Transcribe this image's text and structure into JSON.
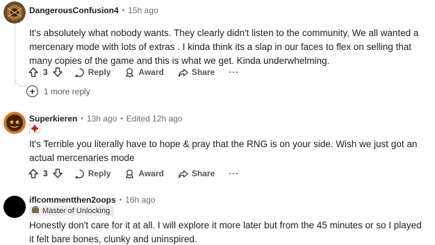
{
  "comments": [
    {
      "username": "DangerousConfusion4",
      "timestamp": "15h ago",
      "edited": "",
      "flair": "",
      "body": "It's absolutely what nobody wants. They clearly didn't listen to the community, We all wanted a mercenary mode with lots of extras . I kinda think its a slap in our faces to flex on selling that many copies of the game and this is what we get. Kinda underwhelming.",
      "votes": "3",
      "reply_label": "Reply",
      "award_label": "Award",
      "share_label": "Share",
      "more_label": "···",
      "more_replies": "1 more reply"
    },
    {
      "username": "Superkieren",
      "timestamp": "13h ago",
      "edited": "Edited 12h ago",
      "flair": "",
      "body": "It's Terrible you literally have to hope & pray that the RNG is on your side. Wish we just got an actual mercenaries mode",
      "votes": "3",
      "reply_label": "Reply",
      "award_label": "Award",
      "share_label": "Share",
      "more_label": "···"
    },
    {
      "username": "iflcommentthen2oops",
      "timestamp": "16h ago",
      "edited": "",
      "flair": "Master of Unlocking",
      "body": "Honestly don't care for it at all. I will explore it more later but from the 45 minutes or so I played it felt bare bones, clunky and uninspired."
    }
  ],
  "colors": {
    "avatar1": "#6b4a2a",
    "avatar2": "#d8741c",
    "avatar3": "#000000",
    "flair_cross": "#b32020"
  }
}
